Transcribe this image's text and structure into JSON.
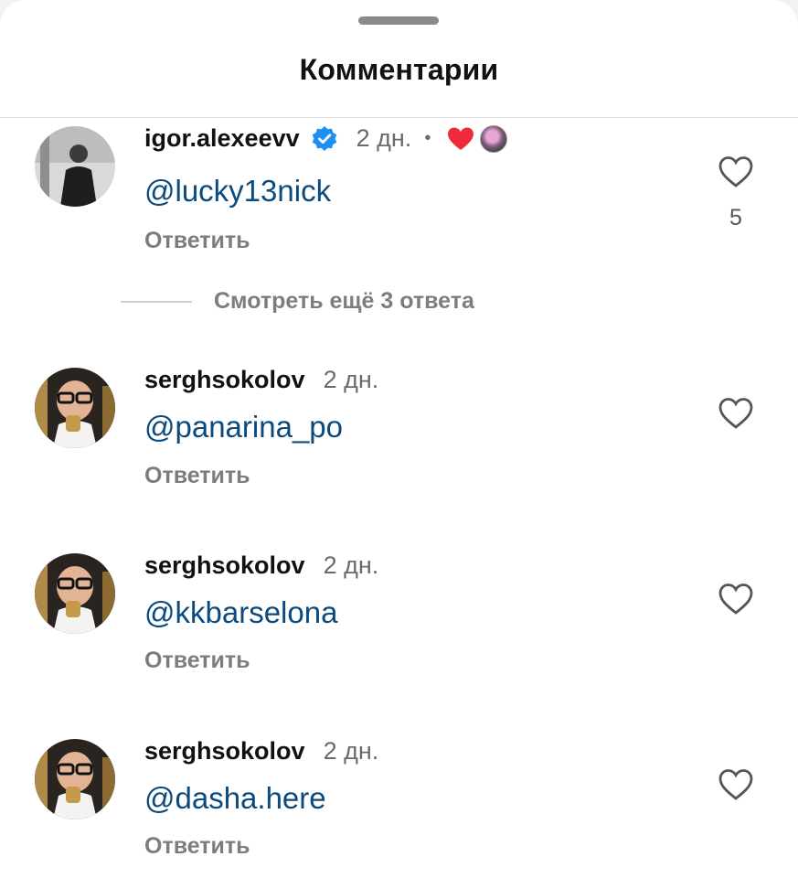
{
  "header": {
    "title": "Комментарии"
  },
  "comments": [
    {
      "username": "igor.alexeevv",
      "verified": true,
      "time": "2 дн.",
      "separator": "•",
      "mention": "@lucky13nick",
      "reply_label": "Ответить",
      "like_count": "5",
      "author_liked": true
    },
    {
      "username": "serghsokolov",
      "verified": false,
      "time": "2 дн.",
      "mention": "@panarina_po",
      "reply_label": "Ответить"
    },
    {
      "username": "serghsokolov",
      "verified": false,
      "time": "2 дн.",
      "mention": "@kkbarselona",
      "reply_label": "Ответить"
    },
    {
      "username": "serghsokolov",
      "verified": false,
      "time": "2 дн.",
      "mention": "@dasha.here",
      "reply_label": "Ответить"
    }
  ],
  "more_replies": {
    "label": "Смотреть ещё 3 ответа"
  },
  "colors": {
    "mention": "#0a4a7f",
    "verified": "#1d8ff2",
    "liked_heart": "#ee2a3c"
  },
  "icons": {
    "verified": "verified-badge-icon",
    "like": "heart-outline-icon",
    "liked": "heart-filled-icon"
  }
}
